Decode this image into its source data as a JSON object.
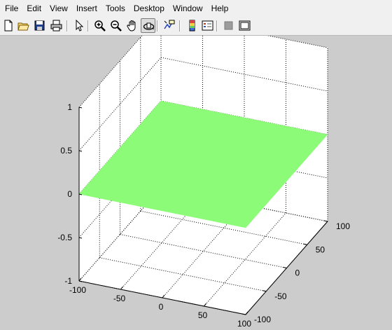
{
  "menu": [
    "File",
    "Edit",
    "View",
    "Insert",
    "Tools",
    "Desktop",
    "Window",
    "Help"
  ],
  "toolbar": {
    "buttons": [
      {
        "name": "new-figure-icon",
        "pressed": false
      },
      {
        "name": "open-file-icon",
        "pressed": false
      },
      {
        "name": "save-icon",
        "pressed": false
      },
      {
        "name": "print-icon",
        "pressed": false
      },
      {
        "name": "edit-plot-arrow-icon",
        "pressed": false
      },
      {
        "name": "zoom-in-icon",
        "pressed": false
      },
      {
        "name": "zoom-out-icon",
        "pressed": false
      },
      {
        "name": "pan-hand-icon",
        "pressed": false
      },
      {
        "name": "rotate-3d-icon",
        "pressed": true
      },
      {
        "name": "data-cursor-icon",
        "pressed": false
      },
      {
        "name": "insert-colorbar-icon",
        "pressed": false
      },
      {
        "name": "insert-legend-icon",
        "pressed": false
      },
      {
        "name": "hide-plot-tools-icon",
        "pressed": false
      },
      {
        "name": "show-plot-tools-icon",
        "pressed": false
      }
    ]
  },
  "colors": {
    "surface": "#8cfc78",
    "figure_background": "#cccccc",
    "axes_background": "#ffffff"
  },
  "chart_data": {
    "type": "surface",
    "surface": {
      "x": [
        -100,
        100
      ],
      "y": [
        -100,
        100
      ],
      "z": [
        [
          0,
          0
        ],
        [
          0,
          0
        ]
      ]
    },
    "xlim": [
      -100,
      100
    ],
    "ylim": [
      -100,
      100
    ],
    "zlim": [
      -1,
      1
    ],
    "xticks": [
      "-100",
      "-50",
      "0",
      "50",
      "100"
    ],
    "yticks": [
      "-100",
      "-50",
      "0",
      "50",
      "100"
    ],
    "zticks": [
      "-1",
      "-0.5",
      "0",
      "0.5",
      "1"
    ],
    "grid": true,
    "box": true,
    "view": "3-D default"
  }
}
